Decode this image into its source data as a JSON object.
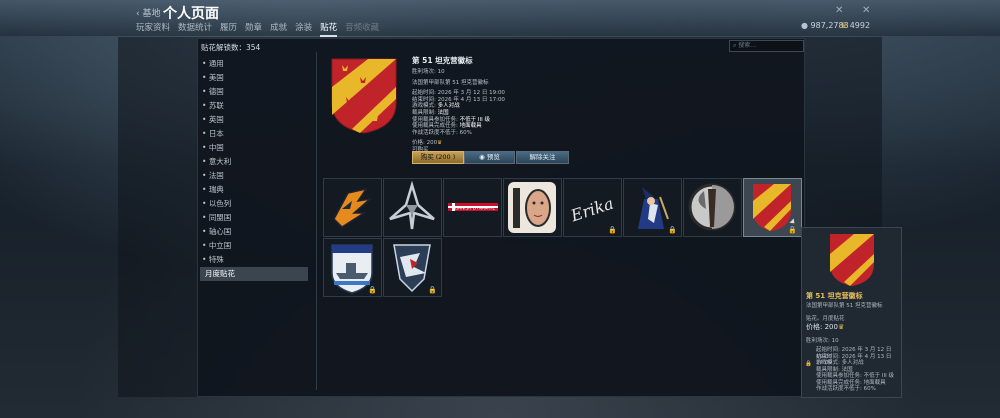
{
  "header": {
    "back_label": "基地",
    "title": "个人页面"
  },
  "tabs": [
    {
      "label": "玩家资料"
    },
    {
      "label": "数据统计"
    },
    {
      "label": "履历"
    },
    {
      "label": "勋章"
    },
    {
      "label": "成就"
    },
    {
      "label": "涂装"
    },
    {
      "label": "贴花"
    },
    {
      "label": "音频收藏"
    }
  ],
  "active_tab": "贴花",
  "currency": {
    "silver": "987,2783",
    "gold": "4992"
  },
  "decals_unlocked": "贴花解锁数：354",
  "search": {
    "placeholder": "搜索..."
  },
  "categories": [
    "通用",
    "美国",
    "德国",
    "苏联",
    "英国",
    "日本",
    "中国",
    "意大利",
    "法国",
    "瑞典",
    "以色列",
    "同盟国",
    "轴心国",
    "中立国",
    "特殊",
    "月度贴花"
  ],
  "active_category": "月度贴花",
  "detail": {
    "name": "第 51 坦克营徽标",
    "wins": "胜利场次: 10",
    "desc": "法国第甲部队第 51 坦克营徽标",
    "start": "起始时间: 2026 年 3 月 12 日 19:00",
    "end": "结束时间: 2026 年 4 月 13 日 17:00",
    "mode_label": "游戏模式: ",
    "mode_value": "多人对战",
    "nation_label": "载具限制: ",
    "nation_value": "法国",
    "tier_label": "使用载具参加任务: ",
    "tier_value": "不低于 III 级",
    "type_label": "使用载具完成任务: ",
    "type_value": "地面载具",
    "ratio": "作战活跃度不低于: 60%",
    "price": "价格: 200",
    "purchasable": "可购买"
  },
  "buttons": {
    "buy": "购买 (200 )",
    "preview": "预览",
    "unfollow": "解除关注"
  },
  "tooltip": {
    "name": "第 51 坦克营徽标",
    "desc": "法国第甲部队第 51 坦克营徽标",
    "category": "贴花。月度贴花",
    "price": "价格: 200",
    "wins": "胜利场次: 10",
    "start": "起始时间: 2026 年 3 月 12 日 19:00",
    "end": "结束时间: 2026 年 4 月 13 日 17:00",
    "mode": "游戏模式: 多人对战",
    "nation": "载具限制: 法国",
    "tier": "使用载具参加任务: 不低于 III 级",
    "type": "使用载具完成任务: 地面载具",
    "ratio": "作战活跃度不低于: 60%"
  },
  "decal_tiles": [
    {
      "icon": "orange-eagle-decal",
      "locked": false
    },
    {
      "icon": "silver-emblem-decal",
      "locked": false
    },
    {
      "icon": "danish-dynamite-decal",
      "text": "DANISH DYNAMITE",
      "locked": false
    },
    {
      "icon": "number-ten-face-decal",
      "text": "10",
      "locked": false
    },
    {
      "icon": "erika-script-decal",
      "text": "Erika",
      "locked": true
    },
    {
      "icon": "wizard-decal",
      "locked": true
    },
    {
      "icon": "axe-decal",
      "locked": false
    },
    {
      "icon": "tank-battalion-51-decal",
      "locked": true
    },
    {
      "icon": "warship-shield-decal",
      "locked": true
    },
    {
      "icon": "bird-shield-decal",
      "locked": true
    }
  ],
  "colors": {
    "gold": "#e9c15e",
    "accent_red": "#c0242a",
    "accent_yellow": "#e8b82a"
  }
}
